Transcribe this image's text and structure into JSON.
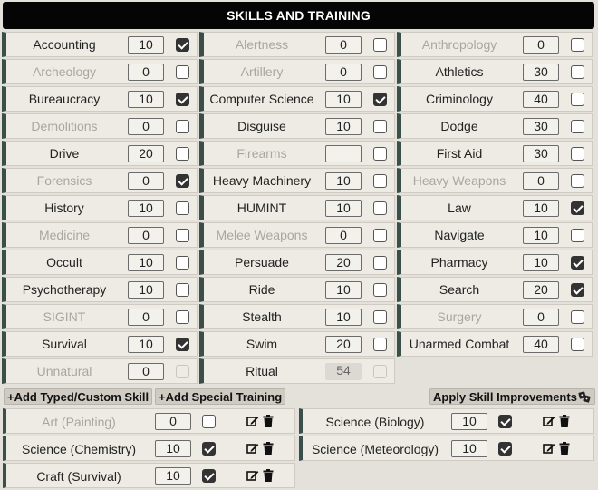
{
  "header": {
    "title": "SKILLS AND TRAINING"
  },
  "skills": [
    {
      "name": "Accounting",
      "value": "10",
      "checked": true,
      "dim": false
    },
    {
      "name": "Alertness",
      "value": "0",
      "checked": false,
      "dim": true
    },
    {
      "name": "Anthropology",
      "value": "0",
      "checked": false,
      "dim": true
    },
    {
      "name": "Archeology",
      "value": "0",
      "checked": false,
      "dim": true
    },
    {
      "name": "Artillery",
      "value": "0",
      "checked": false,
      "dim": true
    },
    {
      "name": "Athletics",
      "value": "30",
      "checked": false,
      "dim": false
    },
    {
      "name": "Bureaucracy",
      "value": "10",
      "checked": true,
      "dim": false
    },
    {
      "name": "Computer Science",
      "value": "10",
      "checked": true,
      "dim": false
    },
    {
      "name": "Criminology",
      "value": "40",
      "checked": false,
      "dim": false
    },
    {
      "name": "Demolitions",
      "value": "0",
      "checked": false,
      "dim": true
    },
    {
      "name": "Disguise",
      "value": "10",
      "checked": false,
      "dim": false
    },
    {
      "name": "Dodge",
      "value": "30",
      "checked": false,
      "dim": false
    },
    {
      "name": "Drive",
      "value": "20",
      "checked": false,
      "dim": false
    },
    {
      "name": "Firearms",
      "value": "",
      "checked": false,
      "dim": true
    },
    {
      "name": "First Aid",
      "value": "30",
      "checked": false,
      "dim": false
    },
    {
      "name": "Forensics",
      "value": "0",
      "checked": true,
      "dim": true
    },
    {
      "name": "Heavy Machinery",
      "value": "10",
      "checked": false,
      "dim": false
    },
    {
      "name": "Heavy Weapons",
      "value": "0",
      "checked": false,
      "dim": true
    },
    {
      "name": "History",
      "value": "10",
      "checked": false,
      "dim": false
    },
    {
      "name": "HUMINT",
      "value": "10",
      "checked": false,
      "dim": false
    },
    {
      "name": "Law",
      "value": "10",
      "checked": true,
      "dim": false
    },
    {
      "name": "Medicine",
      "value": "0",
      "checked": false,
      "dim": true
    },
    {
      "name": "Melee Weapons",
      "value": "0",
      "checked": false,
      "dim": true
    },
    {
      "name": "Navigate",
      "value": "10",
      "checked": false,
      "dim": false
    },
    {
      "name": "Occult",
      "value": "10",
      "checked": false,
      "dim": false
    },
    {
      "name": "Persuade",
      "value": "20",
      "checked": false,
      "dim": false
    },
    {
      "name": "Pharmacy",
      "value": "10",
      "checked": true,
      "dim": false
    },
    {
      "name": "Psychotherapy",
      "value": "10",
      "checked": false,
      "dim": false
    },
    {
      "name": "Ride",
      "value": "10",
      "checked": false,
      "dim": false
    },
    {
      "name": "Search",
      "value": "20",
      "checked": true,
      "dim": false
    },
    {
      "name": "SIGINT",
      "value": "0",
      "checked": false,
      "dim": true
    },
    {
      "name": "Stealth",
      "value": "10",
      "checked": false,
      "dim": false
    },
    {
      "name": "Surgery",
      "value": "0",
      "checked": false,
      "dim": true
    },
    {
      "name": "Survival",
      "value": "10",
      "checked": true,
      "dim": false
    },
    {
      "name": "Swim",
      "value": "20",
      "checked": false,
      "dim": false
    },
    {
      "name": "Unarmed Combat",
      "value": "40",
      "checked": false,
      "dim": false
    },
    {
      "name": "Unnatural",
      "value": "0",
      "checked": false,
      "dim": true,
      "disabledCheck": true
    },
    {
      "name": "Ritual",
      "value": "54",
      "checked": false,
      "dim": false,
      "readonly": true,
      "disabledCheck": true
    }
  ],
  "toolbar": {
    "add_typed_label": "+Add Typed/Custom Skill",
    "add_special_label": "+Add Special Training",
    "apply_label": "Apply Skill Improvements"
  },
  "typed_skills": [
    {
      "name": "Art (Painting)",
      "value": "0",
      "checked": false,
      "dim": true
    },
    {
      "name": "Science (Biology)",
      "value": "10",
      "checked": true,
      "dim": false
    },
    {
      "name": "Science (Chemistry)",
      "value": "10",
      "checked": true,
      "dim": false
    },
    {
      "name": "Science (Meteorology)",
      "value": "10",
      "checked": true,
      "dim": false
    },
    {
      "name": "Craft (Survival)",
      "value": "10",
      "checked": true,
      "dim": false
    }
  ],
  "icons": {
    "edit": "edit-icon",
    "delete": "trash-icon",
    "dice": "dice-icon"
  }
}
